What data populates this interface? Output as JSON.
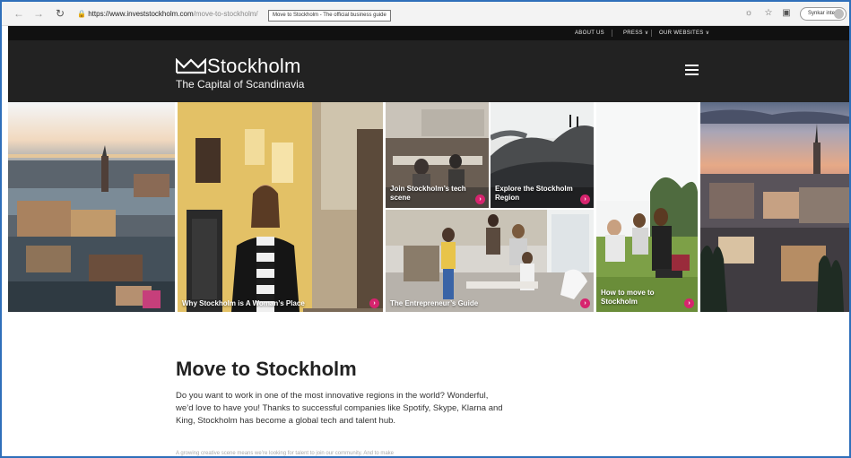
{
  "browser": {
    "url_host": "https://www.investstockholm.com",
    "url_path": "/move-to-stockholm/",
    "tooltip": "Move to Stockholm - The official business guide",
    "sync_label": "Synkar inte"
  },
  "utility_nav": {
    "about": "ABOUT US",
    "press": "PRESS ∨",
    "websites": "OUR WEBSITES ∨"
  },
  "header": {
    "logo_word": "Stockholm",
    "tagline": "The Capital of Scandinavia"
  },
  "tiles": {
    "woman": "Why Stockholm is A Woman’s Place",
    "tech": "Join Stockholm’s tech scene",
    "region": "Explore the Stockholm Region",
    "entrepreneur": "The Entrepreneur’s Guide",
    "move": "How to move to Stockholm",
    "arrow": "›"
  },
  "content": {
    "title": "Move to Stockholm",
    "body": "Do you want to work in one of the most innovative regions in the world? Wonderful, we’d love to have you! Thanks to successful companies like Spotify, Skype, Klarna and King, Stockholm has become a global tech and talent hub.",
    "faded": "A growing creative scene means we’re looking for talent to join our community. And to make"
  },
  "colors": {
    "accent": "#d6246e",
    "header_bg": "#222222",
    "util_bg": "#111111"
  }
}
